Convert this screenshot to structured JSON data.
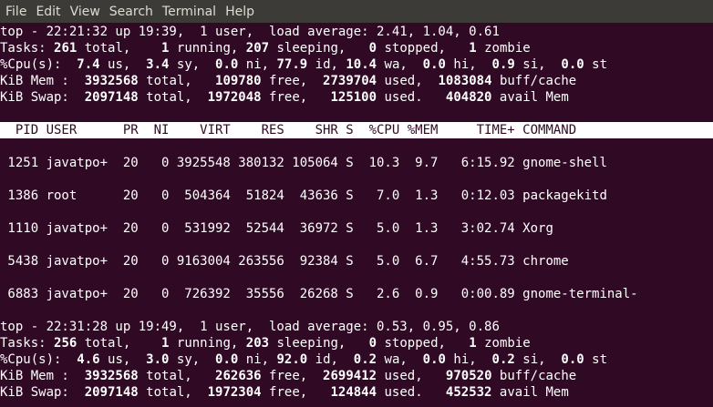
{
  "menubar": [
    "File",
    "Edit",
    "View",
    "Search",
    "Terminal",
    "Help"
  ],
  "snapshot1": {
    "top_line": "top - 22:21:32 up 19:39,  1 user,  load average: 2.41, 1.04, 0.61",
    "tasks": {
      "prefix": "Tasks: ",
      "total": "261",
      "t1": " total,    ",
      "running": "1",
      "t2": " running, ",
      "sleeping": "207",
      "t3": " sleeping,   ",
      "stopped": "0",
      "t4": " stopped,   ",
      "zombie": "1",
      "t5": " zombie"
    },
    "cpu": {
      "prefix": "%Cpu(s):  ",
      "us": "7.4",
      "t1": " us,  ",
      "sy": "3.4",
      "t2": " sy,  ",
      "ni": "0.0",
      "t3": " ni, ",
      "id": "77.9",
      "t4": " id, ",
      "wa": "10.4",
      "t5": " wa,  ",
      "hi": "0.0",
      "t6": " hi,  ",
      "si": "0.9",
      "t7": " si,  ",
      "st": "0.0",
      "t8": " st"
    },
    "mem": {
      "prefix": "KiB Mem :  ",
      "total": "3932568",
      "t1": " total,   ",
      "free": "109780",
      "t2": " free,  ",
      "used": "2739704",
      "t3": " used,  ",
      "buff": "1083084",
      "t4": " buff/cache"
    },
    "swap": {
      "prefix": "KiB Swap:  ",
      "total": "2097148",
      "t1": " total,  ",
      "free": "1972048",
      "t2": " free,   ",
      "used": "125100",
      "t3": " used.   ",
      "avail": "404820",
      "t4": " avail Mem"
    }
  },
  "table": {
    "header": "  PID USER      PR  NI    VIRT    RES    SHR S  %CPU %MEM     TIME+ COMMAND",
    "rows": [
      " 1251 javatpo+  20   0 3925548 380132 105064 S  10.3  9.7   6:15.92 gnome-shell",
      " 1386 root      20   0  504364  51824  43636 S   7.0  1.3   0:12.03 packagekitd",
      " 1110 javatpo+  20   0  531992  52544  36972 S   5.0  1.3   3:02.74 Xorg",
      " 5438 javatpo+  20   0 9163004 263556  92384 S   5.0  6.7   4:55.73 chrome",
      " 6883 javatpo+  20   0  726392  35556  26268 S   2.6  0.9   0:00.89 gnome-terminal-"
    ]
  },
  "snapshot2": {
    "top_line": "top - 22:31:28 up 19:49,  1 user,  load average: 0.53, 0.95, 0.86",
    "tasks": {
      "prefix": "Tasks: ",
      "total": "256",
      "t1": " total,    ",
      "running": "1",
      "t2": " running, ",
      "sleeping": "203",
      "t3": " sleeping,   ",
      "stopped": "0",
      "t4": " stopped,   ",
      "zombie": "1",
      "t5": " zombie"
    },
    "cpu": {
      "prefix": "%Cpu(s):  ",
      "us": "4.6",
      "t1": " us,  ",
      "sy": "3.0",
      "t2": " sy,  ",
      "ni": "0.0",
      "t3": " ni, ",
      "id": "92.0",
      "t4": " id,  ",
      "wa": "0.2",
      "t5": " wa,  ",
      "hi": "0.0",
      "t6": " hi,  ",
      "si": "0.2",
      "t7": " si,  ",
      "st": "0.0",
      "t8": " st"
    },
    "mem": {
      "prefix": "KiB Mem :  ",
      "total": "3932568",
      "t1": " total,   ",
      "free": "262636",
      "t2": " free,  ",
      "used": "2699412",
      "t3": " used,   ",
      "buff": "970520",
      "t4": " buff/cache"
    },
    "swap": {
      "prefix": "KiB Swap:  ",
      "total": "2097148",
      "t1": " total,  ",
      "free": "1972304",
      "t2": " free,   ",
      "used": "124844",
      "t3": " used.   ",
      "avail": "452532",
      "t4": " avail Mem"
    }
  }
}
